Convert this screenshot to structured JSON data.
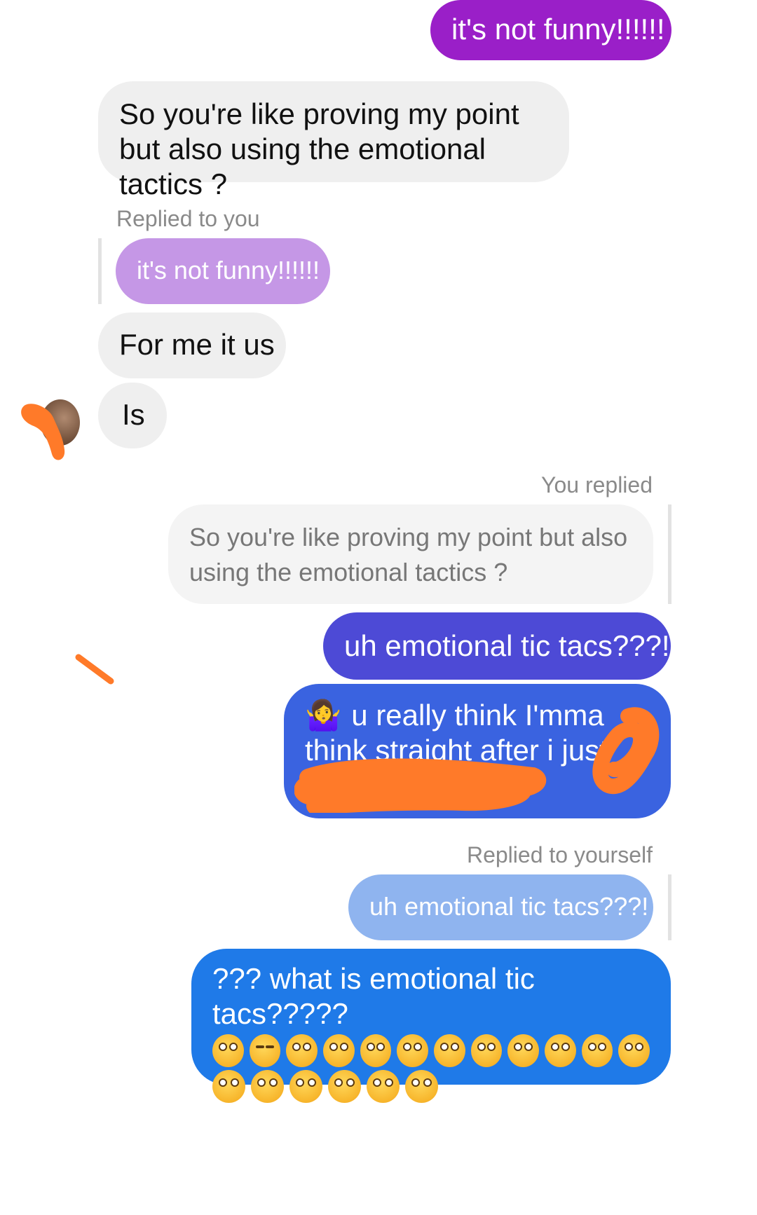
{
  "messages": {
    "m1": "it's not funny!!!!!!",
    "m2": "So you're like proving my point but also using the emotional tactics ?",
    "reply_label_1": "Replied to you",
    "quote_1": "it's not funny!!!!!!",
    "m3": "For me it us",
    "m4": "Is",
    "reply_label_2": "You replied",
    "quote_2": "So you're like proving my point but also using the emotional tactics ?",
    "m5": "uh emotional tic tacs???!",
    "m6_line1": "u really think I'mma",
    "m6_line2": "think straight after i just",
    "m6_emoji": "🤷‍♀️",
    "reply_label_3": "Replied to yourself",
    "quote_3": "uh emotional tic tacs???!",
    "m7": "??? what is emotional tic tacs?????"
  },
  "emoji_rows": [
    [
      "flushed",
      "crying",
      "flushed",
      "flushed",
      "flushed",
      "flushed",
      "flushed",
      "flushed",
      "flushed",
      "flushed",
      "flushed",
      "flushed"
    ],
    [
      "flushed",
      "flushed",
      "flushed",
      "flushed",
      "flushed",
      "flushed"
    ]
  ],
  "colors": {
    "sent_purple": "#9a1fc8",
    "sent_indigo": "#4d4ad6",
    "sent_blue": "#1f7ae8",
    "received": "#efefef",
    "redaction": "#ff7a29"
  }
}
